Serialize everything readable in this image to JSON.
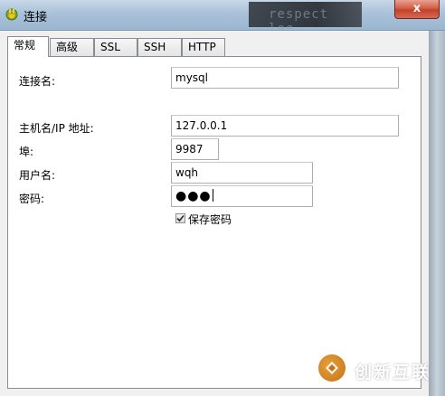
{
  "window": {
    "title": "连接",
    "close_glyph": "x",
    "app_icon": "connection-plug-icon"
  },
  "tabs": [
    {
      "label": "常规",
      "active": true
    },
    {
      "label": "高级",
      "active": false
    },
    {
      "label": "SSL",
      "active": false
    },
    {
      "label": "SSH",
      "active": false
    },
    {
      "label": "HTTP",
      "active": false
    }
  ],
  "form": {
    "connection_name": {
      "label": "连接名:",
      "value": "mysql"
    },
    "host": {
      "label": "主机名/IP 地址:",
      "value": "127.0.0.1"
    },
    "port": {
      "label": "埠:",
      "value": "9987"
    },
    "username": {
      "label": "用户名:",
      "value": "wqh"
    },
    "password": {
      "label": "密码:",
      "value": "●●●"
    },
    "save_password": {
      "label": "保存密码",
      "checked": true
    }
  },
  "watermark": {
    "text": "创新互联"
  },
  "colors": {
    "titlebar": "#a9c1d9",
    "close_button": "#c2412a",
    "panel": "#ffffff",
    "dialog": "#f0f0f0"
  }
}
